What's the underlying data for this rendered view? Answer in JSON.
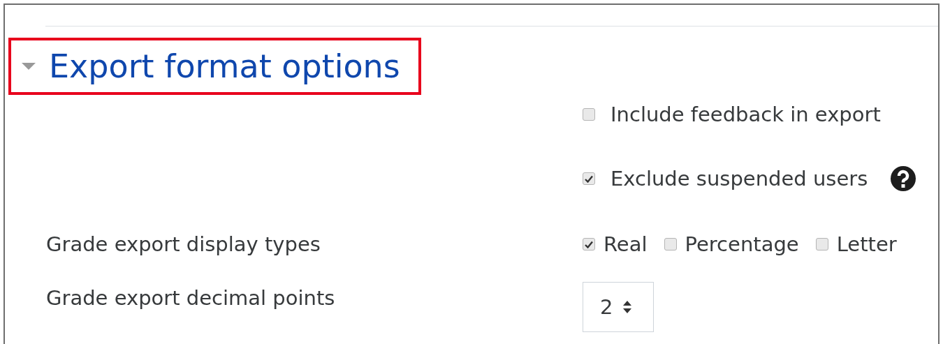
{
  "section": {
    "title": "Export format options",
    "expanded": true,
    "highlighted": true
  },
  "rows": [
    {
      "kind": "checkboxes",
      "options": [
        {
          "label": "Include feedback in export",
          "checked": false
        }
      ]
    },
    {
      "kind": "checkboxes",
      "help": true,
      "options": [
        {
          "label": "Exclude suspended users",
          "checked": true
        }
      ]
    },
    {
      "kind": "checkboxes",
      "label": "Grade export display types",
      "options": [
        {
          "label": "Real",
          "checked": true
        },
        {
          "label": "Percentage",
          "checked": false
        },
        {
          "label": "Letter",
          "checked": false
        }
      ]
    },
    {
      "kind": "select",
      "label": "Grade export decimal points",
      "value": "2"
    }
  ]
}
